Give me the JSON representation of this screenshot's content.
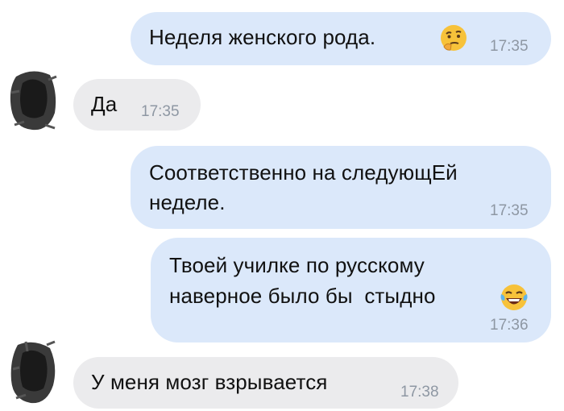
{
  "messages": [
    {
      "direction": "out",
      "text": "Неделя женского рода.",
      "emoji": "thinking-face-icon",
      "time": "17:35"
    },
    {
      "direction": "in",
      "text": "Да",
      "time": "17:35"
    },
    {
      "direction": "out",
      "line1": "Соответственно на следующЕй",
      "line2": "неделе.",
      "time": "17:35"
    },
    {
      "direction": "out",
      "line1": "Твоей училке по русскому",
      "line2": "наверное было бы  стыдно",
      "emoji": "laughing-tears-icon",
      "time": "17:36"
    },
    {
      "direction": "in",
      "text": "У меня мозг взрывается",
      "time": "17:38"
    }
  ],
  "colors": {
    "outgoing_bubble": "#dbe8fa",
    "incoming_bubble": "#ebebed",
    "text": "#111111",
    "timestamp": "#8e97a3"
  }
}
